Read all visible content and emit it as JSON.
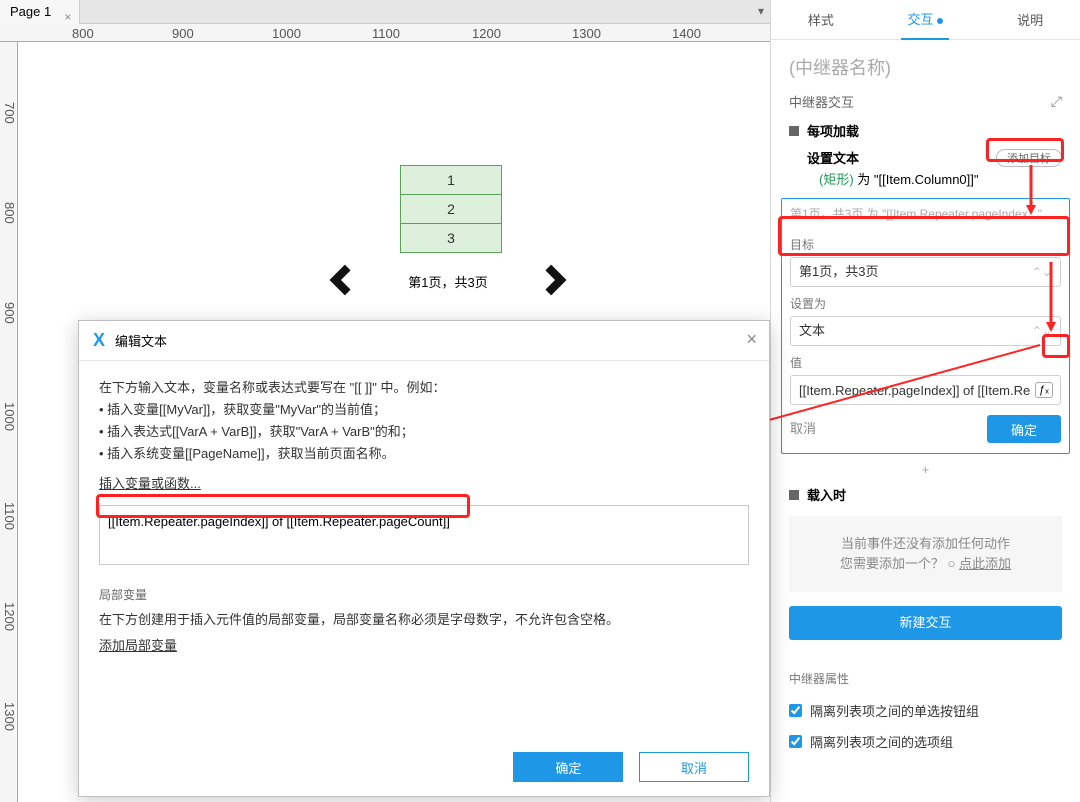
{
  "tabbar": {
    "page_label": "Page 1"
  },
  "ruler_h": [
    "800",
    "900",
    "1000",
    "1100",
    "1200",
    "1300",
    "1400"
  ],
  "ruler_v": [
    "700",
    "800",
    "900",
    "1000",
    "1100",
    "1200",
    "1300"
  ],
  "canvas": {
    "rows": [
      "1",
      "2",
      "3"
    ],
    "page_caption": "第1页，共3页"
  },
  "side": {
    "tab_style": "样式",
    "tab_interaction": "交互",
    "tab_notes": "说明",
    "repeater_name": "(中继器名称)",
    "section_title": "中继器交互",
    "event_each_load": "每项加载",
    "action_set_text": "设置文本",
    "add_target_btn": "添加目标",
    "set_text_desc_shape": "(矩形)",
    "set_text_desc_tail": " 为 \"[[Item.Column0]]\"",
    "grey_top": "第1页，共3页 为 \"[[Item.Repeater.pageIndex...\"",
    "lbl_target": "目标",
    "val_target": "第1页，共3页",
    "lbl_setto": "设置为",
    "val_setto": "文本",
    "lbl_value": "值",
    "val_value": "[[Item.Repeater.pageIndex]] of [[Item.Re",
    "fx_label": "ƒₓ",
    "cancel": "取消",
    "ok": "确定",
    "event_onload": "载入时",
    "no_action_line1": "当前事件还没有添加任何动作",
    "no_action_line2_a": "您需要添加一个？",
    "no_action_link": "点此添加",
    "new_interaction": "新建交互",
    "attr_header": "中继器属性",
    "chk_radio": "隔离列表项之间的单选按钮组",
    "chk_select": "隔离列表项之间的选项组"
  },
  "dialog": {
    "title": "编辑文本",
    "intro": "在下方输入文本，变量名称或表达式要写在 \"[[ ]]\" 中。例如：",
    "b1": "• 插入变量[[MyVar]]，获取变量\"MyVar\"的当前值；",
    "b2": "• 插入表达式[[VarA + VarB]]，获取\"VarA + VarB\"的和；",
    "b3": "• 插入系统变量[[PageName]]，获取当前页面名称。",
    "insert_link": "插入变量或函数...",
    "expr_value": "[[Item.Repeater.pageIndex]] of [[Item.Repeater.pageCount]]",
    "localvar_title": "局部变量",
    "localvar_desc": "在下方创建用于插入元件值的局部变量，局部变量名称必须是字母数字，不允许包含空格。",
    "add_localvar": "添加局部变量",
    "ok": "确定",
    "cancel": "取消"
  }
}
